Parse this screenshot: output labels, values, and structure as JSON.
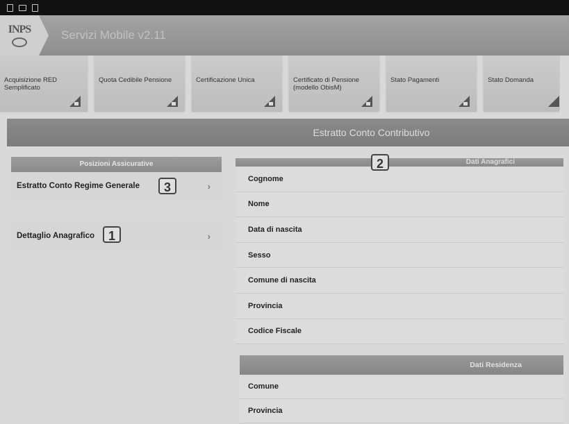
{
  "app": {
    "title": "Servizi Mobile v2.11",
    "logo_text": "INPS"
  },
  "tiles": [
    {
      "label": "Acquisizione RED Semplificato"
    },
    {
      "label": "Quota Cedibile Pensione"
    },
    {
      "label": "Certificazione Unica"
    },
    {
      "label": "Certificato di Pensione (modello ObisM)"
    },
    {
      "label": "Stato Pagamenti"
    },
    {
      "label": "Stato Domanda"
    }
  ],
  "section": {
    "title": "Estratto Conto Contributivo"
  },
  "left_panel": {
    "header": "Posizioni Assicurative",
    "items": [
      {
        "label": "Estratto Conto Regime Generale",
        "badge": "3"
      },
      {
        "label": "Dettaglio Anagrafico",
        "badge": "1"
      }
    ]
  },
  "anagrafici": {
    "header": "Dati Anagrafici",
    "badge": "2",
    "fields": [
      "Cognome",
      "Nome",
      "Data di nascita",
      "Sesso",
      "Comune di nascita",
      "Provincia",
      "Codice Fiscale"
    ]
  },
  "residenza": {
    "header": "Dati Residenza",
    "fields": [
      "Comune",
      "Provincia"
    ]
  },
  "colors": {
    "header_gray": "#7c7c7c",
    "background": "#d9d9d9"
  }
}
